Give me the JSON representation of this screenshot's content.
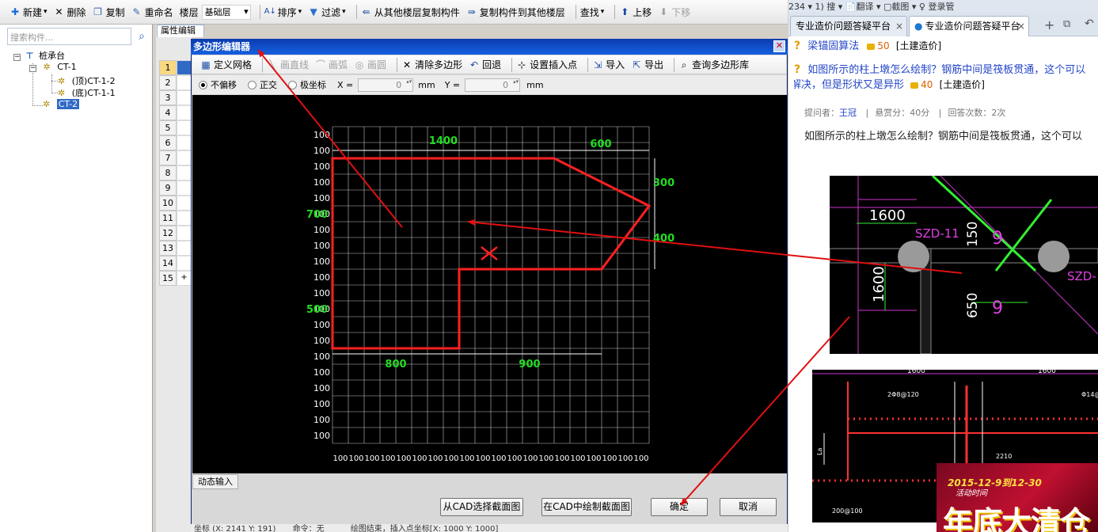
{
  "toolbar": {
    "new": "新建",
    "delete": "删除",
    "copy": "复制",
    "rename": "重命名",
    "floor_label": "楼层",
    "floor_value": "基础层",
    "sort": "排序",
    "filter": "过滤",
    "copy_from_floor": "从其他楼层复制构件",
    "copy_to_floor": "复制构件到其他楼层",
    "find": "查找",
    "move_up": "上移",
    "move_down": "下移"
  },
  "left": {
    "search_placeholder": "搜索构件...",
    "tree": {
      "root": "桩承台",
      "ct1": "CT-1",
      "ct1_top": "(顶)CT-1-2",
      "ct1_bottom": "(底)CT-1-1",
      "ct2": "CT-2"
    }
  },
  "properties": {
    "tab": "属性编辑",
    "rows": [
      "1",
      "2",
      "3",
      "4",
      "5",
      "6",
      "7",
      "8",
      "9",
      "10",
      "11",
      "12",
      "13",
      "14",
      "15"
    ],
    "add": "+"
  },
  "dialog": {
    "title": "多边形编辑器",
    "tools": {
      "define_grid": "定义网格",
      "draw_line": "画直线",
      "draw_arc": "画弧",
      "draw_circle": "画圆",
      "clear": "清除多边形",
      "undo": "回退",
      "set_insert": "设置插入点",
      "import": "导入",
      "export": "导出",
      "query_lib": "查询多边形库"
    },
    "options": {
      "no_offset": "不偏移",
      "orthogonal": "正交",
      "polar": "极坐标",
      "x_label": "X =",
      "x_value": "0",
      "x_unit": "mm",
      "y_label": "Y =",
      "y_value": "0",
      "y_unit": "mm"
    },
    "dynamic_input": "动态输入",
    "buttons": {
      "select_cad": "从CAD选择截面图",
      "draw_cad": "在CAD中绘制截面图",
      "ok": "确定",
      "cancel": "取消"
    },
    "status": {
      "coords": "坐标 (X: 2141 Y: 191)",
      "command": "命令：无",
      "hint": "绘图结束，插入点坐标[X: 1000 Y: 1000]"
    }
  },
  "canvas": {
    "row_label": "100",
    "col_label": "100",
    "rows": 20,
    "cols": 20,
    "dims": {
      "top_left": "1400",
      "top_right": "600",
      "right_top": "300",
      "right_bottom": "400",
      "left_top": "700",
      "left_bottom": "500",
      "bottom_left": "800",
      "bottom_right": "900"
    },
    "colors": {
      "grid": "#ffffff",
      "shape": "#ff2020",
      "dims": "#22dd22"
    }
  },
  "browser": {
    "top_strip": "234 ▾    1) 搜 ▾   📄翻译 ▾   ▢截图 ▾    ♀ 登录管",
    "tab1": "专业造价问题答疑平台",
    "tab2": "专业造价问题答疑平台",
    "q1_title": "梁锚固算法",
    "q1_coins": "50",
    "q1_cat": "[土建造价]",
    "q2_title": "如图所示的柱上墩怎么绘制？钢筋中间是筏板贯通，这个可以",
    "q2_title2": "解决，但是形状又是异形",
    "q2_coins": "40",
    "q2_cat": "[土建造价]",
    "asker_label": "提问者：",
    "asker": "王冠",
    "reward": "悬赏分：40分",
    "answers": "回答次数：2次",
    "body": "如图所示的柱上墩怎么绘制？钢筋中间是筏板贯通，这个可以",
    "cad": {
      "d1600": "1600",
      "szd11": "SZD-11",
      "d150": "150",
      "d1600v": "1600",
      "d650": "650",
      "d9": "9",
      "szd": "SZD-",
      "d2210": "2210",
      "d1600b": "1600",
      "d1600c": "1600",
      "rebar1": "2Φ8@120",
      "rebar2": "Φ14@",
      "ld": "La",
      "d200": "200@100"
    },
    "ad": {
      "date": "2015-12-9到12-30",
      "label": "活动时间",
      "big": "年底大清仓"
    }
  }
}
